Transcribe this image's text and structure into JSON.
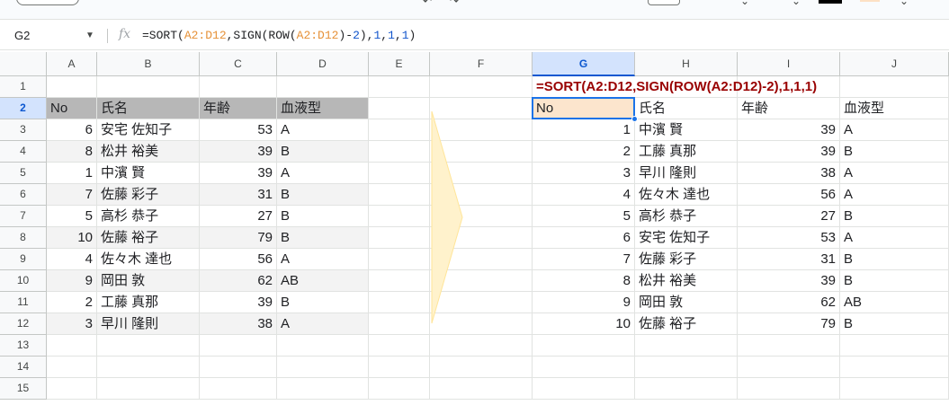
{
  "formula_bar": {
    "name_box": "G2",
    "fx_label": "fx",
    "formula_parts": [
      {
        "text": "=SORT(",
        "kind": "plain"
      },
      {
        "text": "A2:D12",
        "kind": "range"
      },
      {
        "text": ",SIGN(ROW(",
        "kind": "plain"
      },
      {
        "text": "A2:D12",
        "kind": "range"
      },
      {
        "text": ")-",
        "kind": "plain"
      },
      {
        "text": "2",
        "kind": "number"
      },
      {
        "text": "),",
        "kind": "plain"
      },
      {
        "text": "1",
        "kind": "number"
      },
      {
        "text": ",",
        "kind": "plain"
      },
      {
        "text": "1",
        "kind": "number"
      },
      {
        "text": ",",
        "kind": "plain"
      },
      {
        "text": "1",
        "kind": "number"
      },
      {
        "text": ")",
        "kind": "plain"
      }
    ]
  },
  "columns": [
    "A",
    "B",
    "C",
    "D",
    "E",
    "F",
    "G",
    "H",
    "I",
    "J"
  ],
  "rows": [
    "1",
    "2",
    "3",
    "4",
    "5",
    "6",
    "7",
    "8",
    "9",
    "10",
    "11",
    "12",
    "13",
    "14",
    "15"
  ],
  "selected_cell": {
    "column": "G",
    "row": "2"
  },
  "colors": {
    "header_fill": "#b7b7b7",
    "band_fill": "#f3f3f3",
    "formula_text": "#990000",
    "selected_cell_fill": "#fce5cd",
    "selection_border": "#1a73e8",
    "arrow_fill": "#fff2cc"
  },
  "source_table": {
    "headers": [
      "No",
      "氏名",
      "年齢",
      "血液型"
    ],
    "rows": [
      [
        "6",
        "安宅 佐知子",
        "53",
        "A"
      ],
      [
        "8",
        "松井 裕美",
        "39",
        "B"
      ],
      [
        "1",
        "中濱 賢",
        "39",
        "A"
      ],
      [
        "7",
        "佐藤 彩子",
        "31",
        "B"
      ],
      [
        "5",
        "高杉 恭子",
        "27",
        "B"
      ],
      [
        "10",
        "佐藤 裕子",
        "79",
        "B"
      ],
      [
        "4",
        "佐々木 達也",
        "56",
        "A"
      ],
      [
        "9",
        "岡田 敦",
        "62",
        "AB"
      ],
      [
        "2",
        "工藤 真那",
        "39",
        "B"
      ],
      [
        "3",
        "早川 隆則",
        "38",
        "A"
      ]
    ]
  },
  "result_formula_cell": "=SORT(A2:D12,SIGN(ROW(A2:D12)-2),1,1,1)",
  "result_table": {
    "headers": [
      "No",
      "氏名",
      "年齢",
      "血液型"
    ],
    "rows": [
      [
        "1",
        "中濱 賢",
        "39",
        "A"
      ],
      [
        "2",
        "工藤 真那",
        "39",
        "B"
      ],
      [
        "3",
        "早川 隆則",
        "38",
        "A"
      ],
      [
        "4",
        "佐々木 達也",
        "56",
        "A"
      ],
      [
        "5",
        "高杉 恭子",
        "27",
        "B"
      ],
      [
        "6",
        "安宅 佐知子",
        "53",
        "A"
      ],
      [
        "7",
        "佐藤 彩子",
        "31",
        "B"
      ],
      [
        "8",
        "松井 裕美",
        "39",
        "B"
      ],
      [
        "9",
        "岡田 敦",
        "62",
        "AB"
      ],
      [
        "10",
        "佐藤 裕子",
        "79",
        "B"
      ]
    ]
  }
}
